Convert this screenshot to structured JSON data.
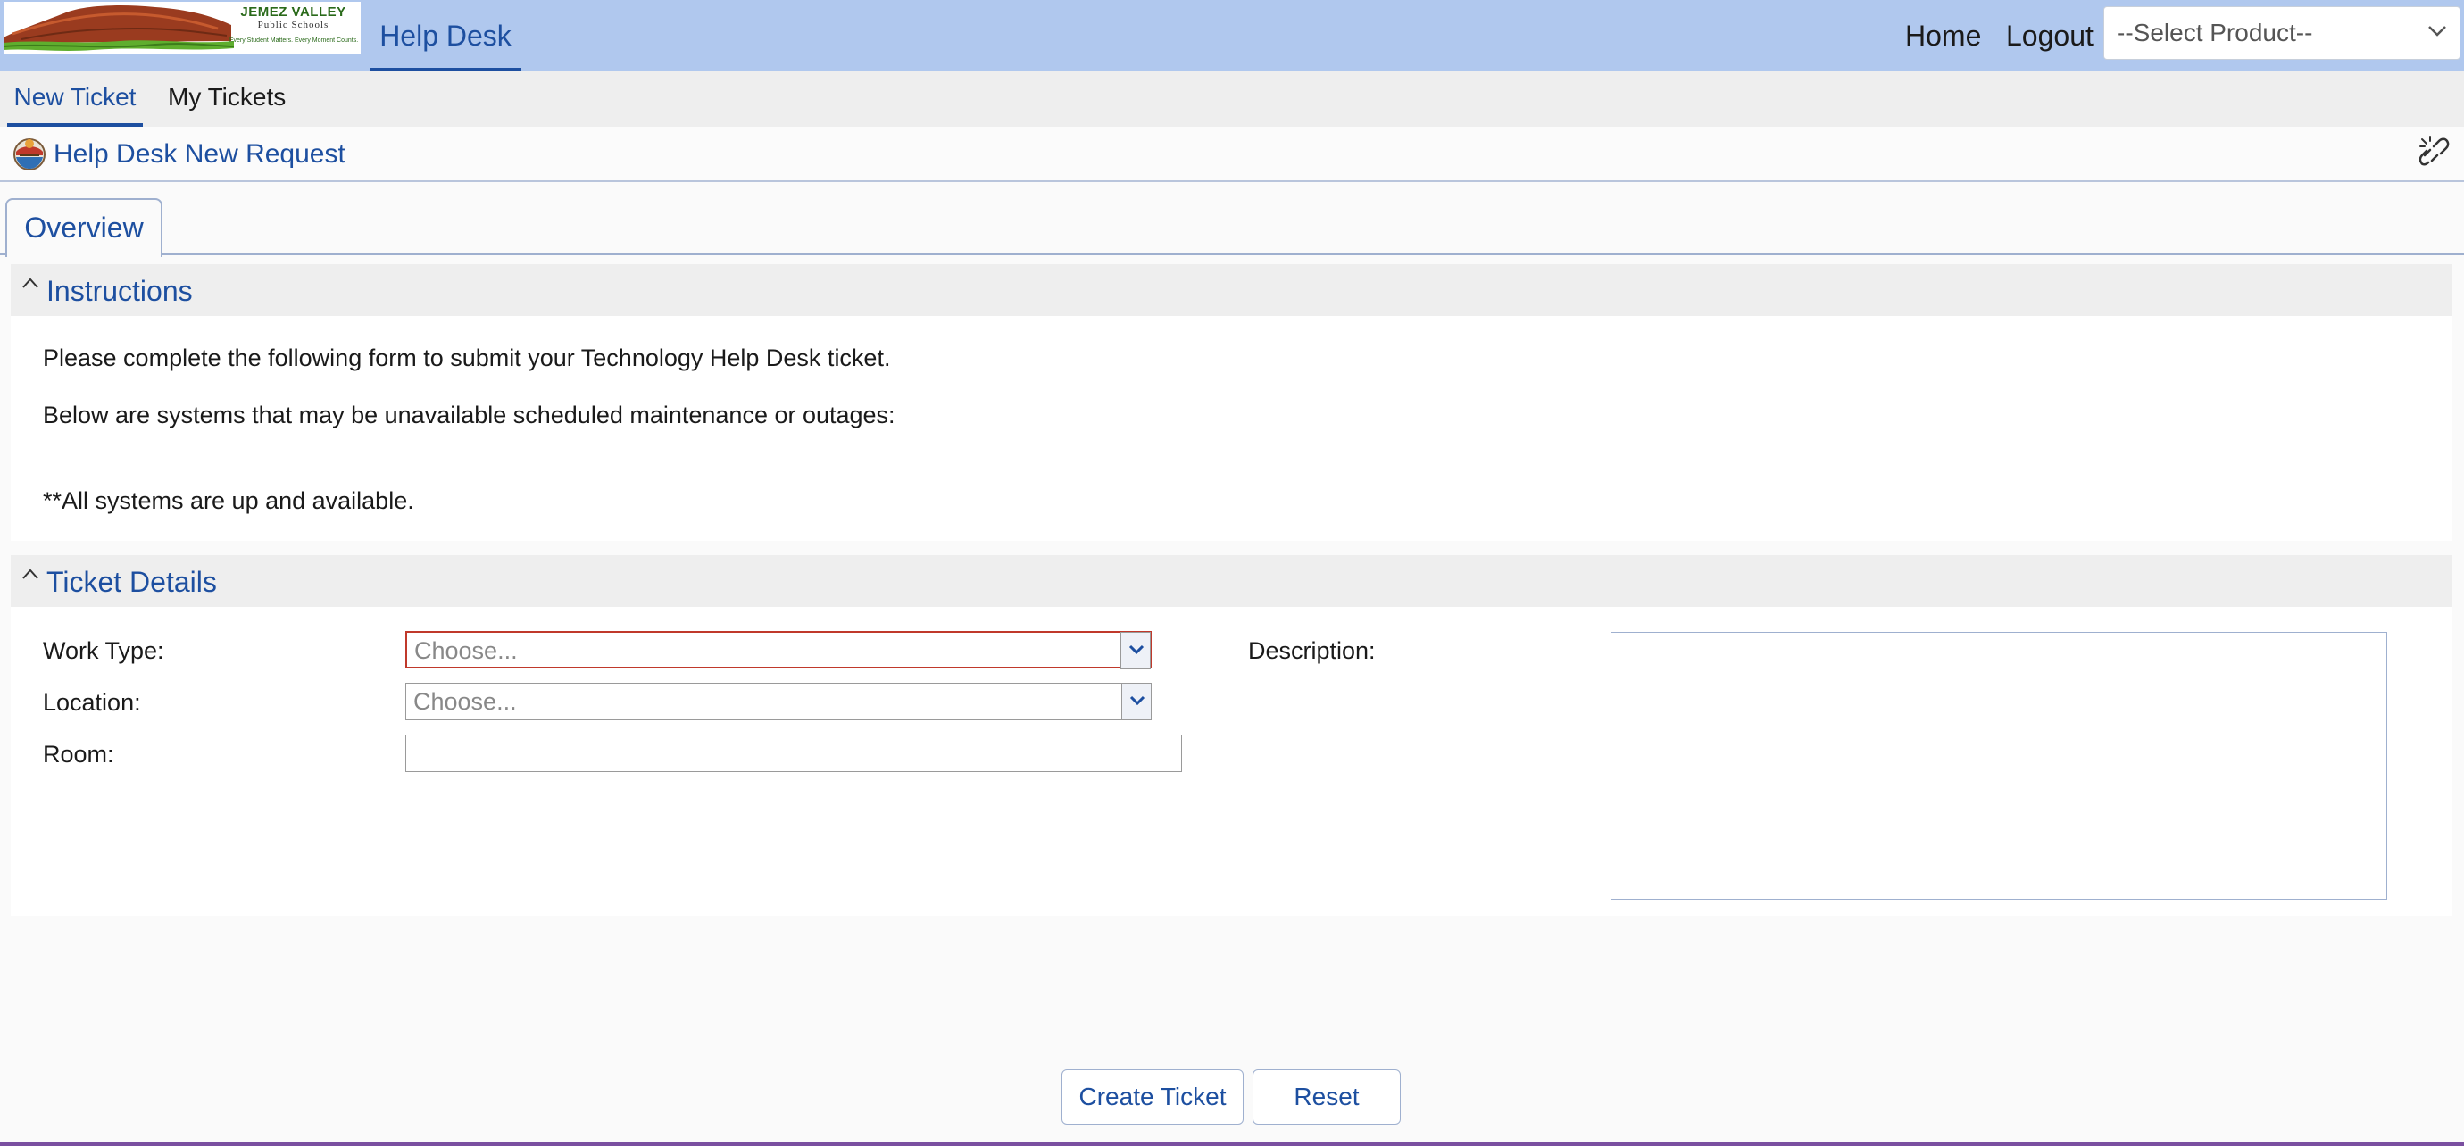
{
  "header": {
    "logo": {
      "line1": "JEMEZ VALLEY",
      "line2": "Public Schools",
      "line3": "Every Student Matters. Every Moment Counts."
    },
    "app_title": "Help Desk",
    "links": {
      "home": "Home",
      "logout": "Logout"
    },
    "product_select": {
      "selected": "--Select Product--"
    }
  },
  "subnav": {
    "items": [
      {
        "label": "New Ticket",
        "active": true
      },
      {
        "label": "My Tickets",
        "active": false
      }
    ]
  },
  "page": {
    "title": "Help Desk New Request"
  },
  "tabs": [
    {
      "label": "Overview",
      "active": true
    }
  ],
  "instructions": {
    "title": "Instructions",
    "lines": [
      "Please complete the following form to submit your Technology Help Desk ticket.",
      "Below are systems that may be unavailable scheduled maintenance or outages:",
      "**All systems are up and available."
    ]
  },
  "ticket_details": {
    "title": "Ticket Details",
    "work_type": {
      "label": "Work Type:",
      "placeholder": "Choose...",
      "value": ""
    },
    "location": {
      "label": "Location:",
      "placeholder": "Choose...",
      "value": ""
    },
    "room": {
      "label": "Room:",
      "value": ""
    },
    "description": {
      "label": "Description:",
      "value": ""
    }
  },
  "actions": {
    "create": "Create Ticket",
    "reset": "Reset"
  },
  "colors": {
    "header_bg": "#b0c8ee",
    "accent": "#1d4fa0",
    "section_bg": "#eeeeee",
    "invalid": "#c0392b"
  },
  "icons": {
    "title": "helpdesk-globe-icon",
    "unlink": "unlink-icon",
    "dropdown": "chevron-down-icon",
    "collapse": "chevron-up-icon"
  }
}
